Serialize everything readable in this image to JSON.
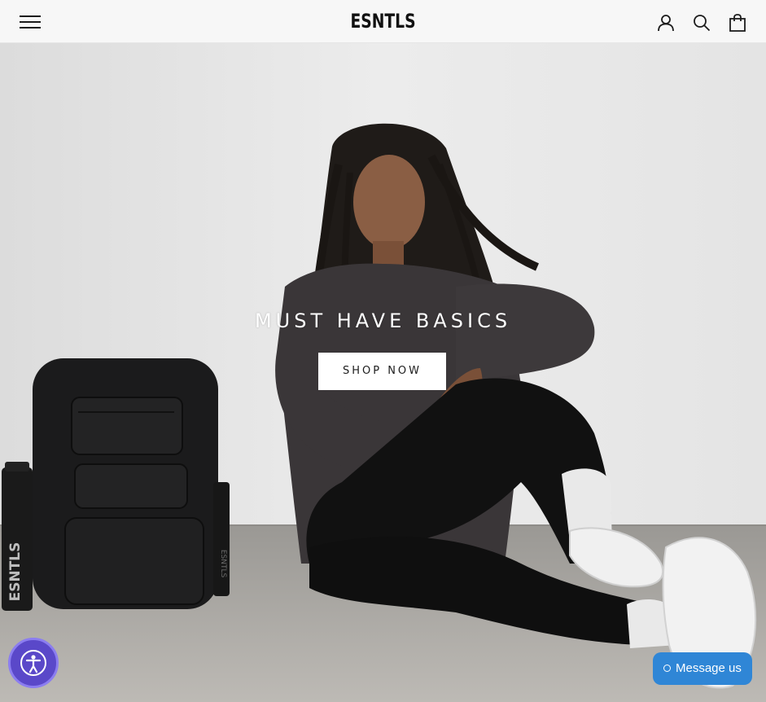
{
  "header": {
    "brand": "ESNTLS",
    "icons": [
      "menu-icon",
      "account-icon",
      "search-icon",
      "cart-icon"
    ]
  },
  "hero": {
    "title": "MUST HAVE BASICS",
    "cta_label": "SHOP NOW",
    "bottle_text": "ESNTLS",
    "strap_text": "ESNTLS"
  },
  "widgets": {
    "message_label": "Message us",
    "accessibility_icon": "accessibility-icon"
  },
  "colors": {
    "accessibility": "#5a48c9",
    "message": "#2f86d6",
    "header_bg": "#f7f7f7"
  }
}
